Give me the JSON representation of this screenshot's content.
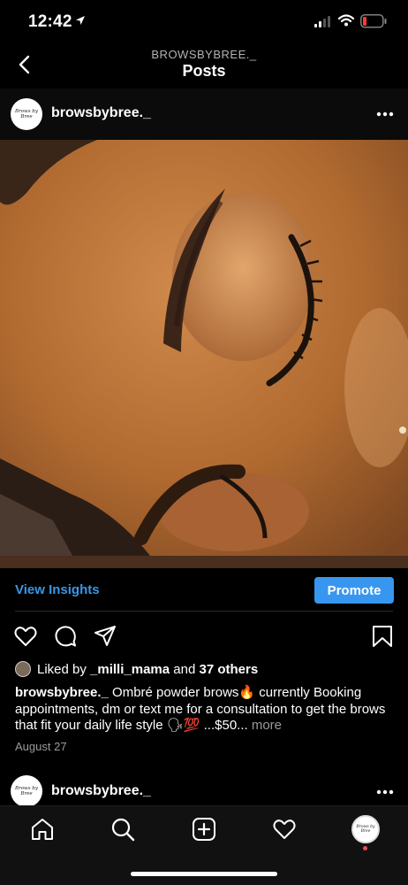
{
  "status_bar": {
    "time": "12:42"
  },
  "nav": {
    "subtitle": "BROWSBYBREE._",
    "title": "Posts"
  },
  "post": {
    "username": "browsbybree._",
    "avatar_text": "Brows by Bree",
    "view_insights": "View Insights",
    "promote": "Promote",
    "liked_by_prefix": "Liked by",
    "liked_by_user": "_milli_mama",
    "liked_by_and": "and",
    "liked_by_others": "37 others",
    "caption_user": "browsbybree._",
    "caption_text": "Ombré powder brows🔥 currently Booking appointments, dm or text me for a consultation to get the brows that fit your daily life style 🗣💯 ...$50...",
    "caption_more": "more",
    "date": "August 27"
  },
  "next_post": {
    "username": "browsbybree._",
    "avatar_text": "Brows by Bree"
  },
  "colors": {
    "accent": "#3797f0",
    "link": "#3a96e8",
    "background": "#000000",
    "notification": "#ed4956"
  },
  "icons": [
    "back-chevron-icon",
    "more-icon",
    "heart-icon",
    "comment-icon",
    "share-icon",
    "bookmark-icon",
    "home-icon",
    "search-icon",
    "add-icon",
    "activity-heart-icon",
    "profile-avatar-icon"
  ]
}
